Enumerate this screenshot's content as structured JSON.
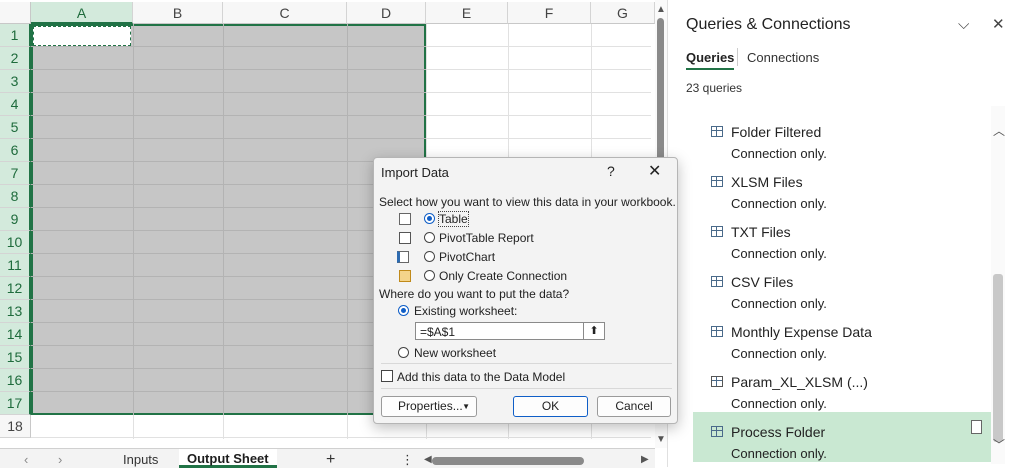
{
  "sheet": {
    "columns": [
      "A",
      "B",
      "C",
      "D",
      "E",
      "F",
      "G"
    ],
    "rows": [
      "1",
      "2",
      "3",
      "4",
      "5",
      "6",
      "7",
      "8",
      "9",
      "10",
      "11",
      "12",
      "13",
      "14",
      "15",
      "16",
      "17",
      "18"
    ],
    "tabs": {
      "inputs": "Inputs",
      "output": "Output Sheet",
      "add": "+",
      "more": "⋮"
    }
  },
  "panel": {
    "title": "Queries & Connections",
    "tab_queries": "Queries",
    "tab_connections": "Connections",
    "count": "23 queries",
    "items": [
      {
        "name": "Folder Filtered",
        "sub": "Connection only."
      },
      {
        "name": "XLSM Files",
        "sub": "Connection only."
      },
      {
        "name": "TXT Files",
        "sub": "Connection only."
      },
      {
        "name": "CSV Files",
        "sub": "Connection only."
      },
      {
        "name": "Monthly Expense Data",
        "sub": "Connection only."
      },
      {
        "name": "Param_XL_XLSM (...)",
        "sub": "Connection only."
      },
      {
        "name": "Process Folder",
        "sub": "Connection only."
      }
    ]
  },
  "dialog": {
    "title": "Import Data",
    "help": "?",
    "close": "✕",
    "view_prompt": "Select how you want to view this data in your workbook.",
    "opt_table": "Table",
    "opt_pivot_table": "PivotTable Report",
    "opt_pivot_chart": "PivotChart",
    "opt_connection": "Only Create Connection",
    "put_prompt": "Where do you want to put the data?",
    "opt_existing": "Existing worksheet:",
    "ref_value": "=$A$1",
    "opt_new": "New worksheet",
    "data_model": "Add this data to the Data Model",
    "properties": "Properties...",
    "ok": "OK",
    "cancel": "Cancel"
  },
  "colors": {
    "excel_green": "#217346",
    "selection_gray": "#c6c6c6",
    "selected_query": "#c9e8d2",
    "dialog_accent": "#0f5ec7"
  }
}
